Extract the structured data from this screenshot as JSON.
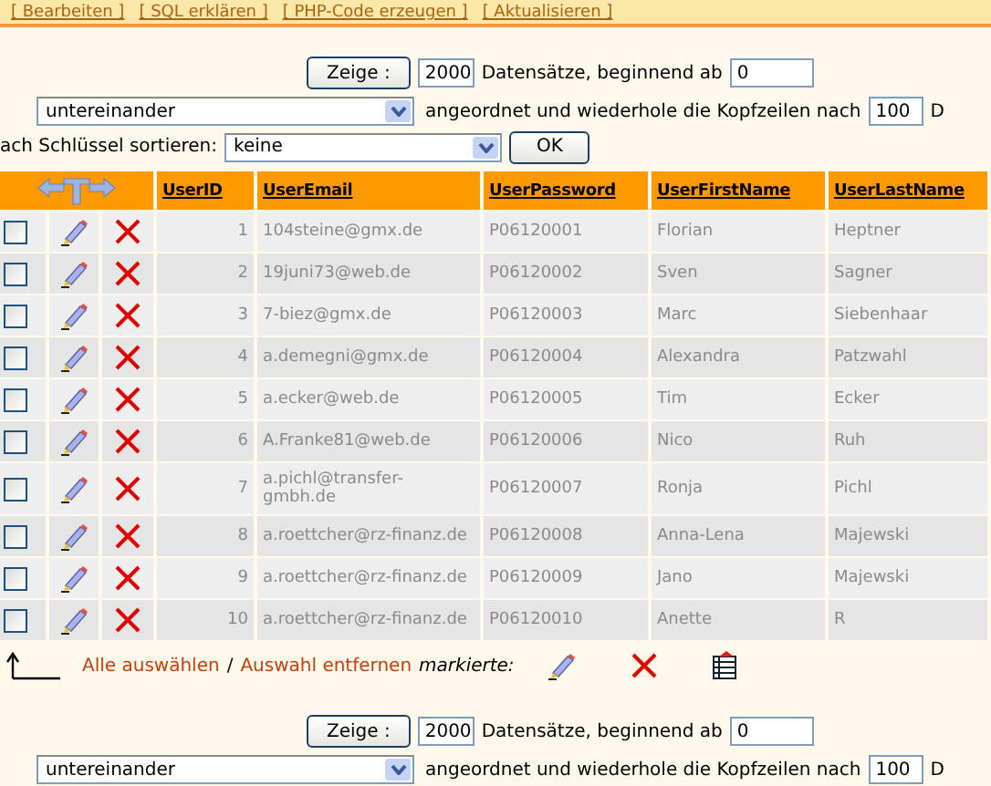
{
  "top_links": [
    "[ Bearbeiten ]",
    "[ SQL erklären ]",
    "[ PHP-Code erzeugen ]",
    "[ Aktualisieren ]"
  ],
  "nav_top": {
    "show_button": "Zeige :",
    "rows_value": "2000",
    "start_label": "Datensätze, beginnend ab",
    "start_value": "0",
    "mode_value": "untereinander",
    "repeat_label": "angeordnet und wiederhole die Kopfzeilen nach",
    "repeat_value": "100",
    "trailing": "D"
  },
  "sort": {
    "label": "ach Schlüssel sortieren:",
    "value": "keine",
    "button": "OK"
  },
  "table": {
    "columns": [
      "UserID",
      "UserEmail",
      "UserPassword",
      "UserFirstName",
      "UserLastName"
    ],
    "rows": [
      {
        "checked": false,
        "cells": [
          "1",
          "104steine@gmx.de",
          "P06120001",
          "Florian",
          "Heptner"
        ]
      },
      {
        "checked": false,
        "cells": [
          "2",
          "19juni73@web.de",
          "P06120002",
          "Sven",
          "Sagner"
        ]
      },
      {
        "checked": false,
        "cells": [
          "3",
          "7-biez@gmx.de",
          "P06120003",
          "Marc",
          "Siebenhaar"
        ]
      },
      {
        "checked": false,
        "cells": [
          "4",
          "a.demegni@gmx.de",
          "P06120004",
          "Alexandra",
          "Patzwahl"
        ]
      },
      {
        "checked": false,
        "cells": [
          "5",
          "a.ecker@web.de",
          "P06120005",
          "Tim",
          "Ecker"
        ]
      },
      {
        "checked": false,
        "cells": [
          "6",
          "A.Franke81@web.de",
          "P06120006",
          "Nico",
          "Ruh"
        ]
      },
      {
        "checked": false,
        "cells": [
          "7",
          "a.pichl@transfer-gmbh.de",
          "P06120007",
          "Ronja",
          "Pichl"
        ]
      },
      {
        "checked": false,
        "cells": [
          "8",
          "a.roettcher@rz-finanz.de",
          "P06120008",
          "Anna-Lena",
          "Majewski"
        ]
      },
      {
        "checked": false,
        "cells": [
          "9",
          "a.roettcher@rz-finanz.de",
          "P06120009",
          "Jano",
          "Majewski"
        ]
      },
      {
        "checked": false,
        "cells": [
          "10",
          "a.roettcher@rz-finanz.de",
          "P06120010",
          "Anette",
          "R"
        ]
      }
    ]
  },
  "actions": {
    "select_all": "Alle auswählen",
    "separator": "/",
    "deselect": "Auswahl entfernen",
    "marked_label": "markierte:"
  },
  "nav_bottom": {
    "show_button": "Zeige :",
    "rows_value": "2000",
    "start_label": "Datensätze, beginnend ab",
    "start_value": "0",
    "mode_value": "untereinander",
    "repeat_label": "angeordnet und wiederhole die Kopfzeilen nach",
    "repeat_value": "100",
    "trailing": "D"
  }
}
